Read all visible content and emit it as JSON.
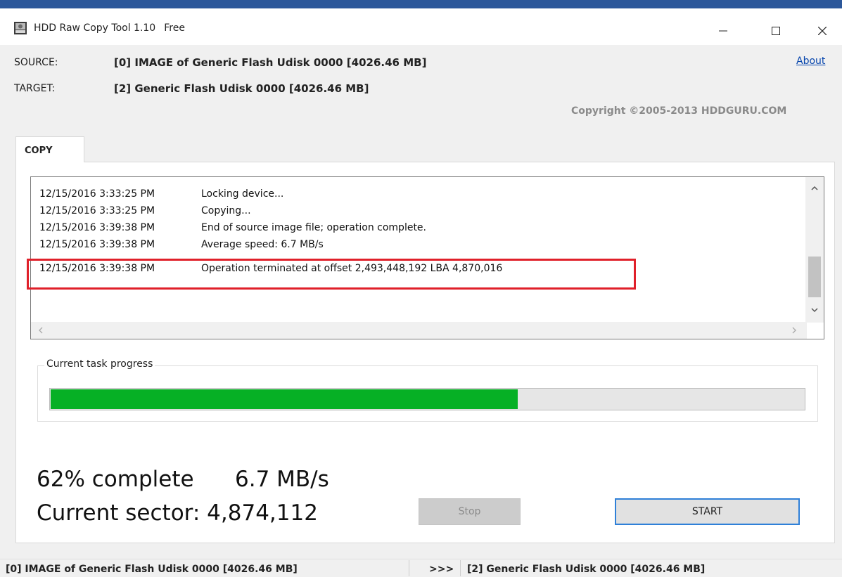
{
  "window": {
    "app_name": "HDD Raw Copy Tool 1.10",
    "edition": "Free"
  },
  "header": {
    "source_label": "SOURCE:",
    "source_value": "[0]  IMAGE of Generic Flash Udisk   0000   [4026.46 MB]",
    "target_label": "TARGET:",
    "target_value": "[2]  Generic Flash Udisk   0000   [4026.46 MB]",
    "about_link": "About",
    "copyright": "Copyright ©2005-2013 HDDGURU.COM"
  },
  "tabs": [
    {
      "label": "COPY"
    }
  ],
  "log": {
    "entries": [
      {
        "time": "12/15/2016 3:33:25 PM",
        "message": "Locking device..."
      },
      {
        "time": "12/15/2016 3:33:25 PM",
        "message": "Copying..."
      },
      {
        "time": "12/15/2016 3:39:38 PM",
        "message": "End of source image file; operation complete."
      },
      {
        "time": "12/15/2016 3:39:38 PM",
        "message": "Average speed: 6.7 MB/s"
      },
      {
        "time": "12/15/2016 3:39:38 PM",
        "message": "Operation terminated at offset 2,493,448,192    LBA 4,870,016"
      }
    ],
    "highlighted_entry_index": 4,
    "highlight_color": "#e0202a"
  },
  "progress": {
    "group_label": "Current task progress",
    "fraction": 0.62,
    "fill_color": "#06b025"
  },
  "stats": {
    "percent_text": "62% complete",
    "speed_text": "6.7 MB/s",
    "sector_text": "Current sector: 4,874,112"
  },
  "buttons": {
    "stop_label": "Stop",
    "start_label": "START"
  },
  "statusbar": {
    "source": "[0]  IMAGE of Generic Flash Udisk   0000   [4026.46 MB]",
    "arrow": ">>>",
    "target": "[2]  Generic Flash Udisk   0000   [4026.46 MB]"
  }
}
